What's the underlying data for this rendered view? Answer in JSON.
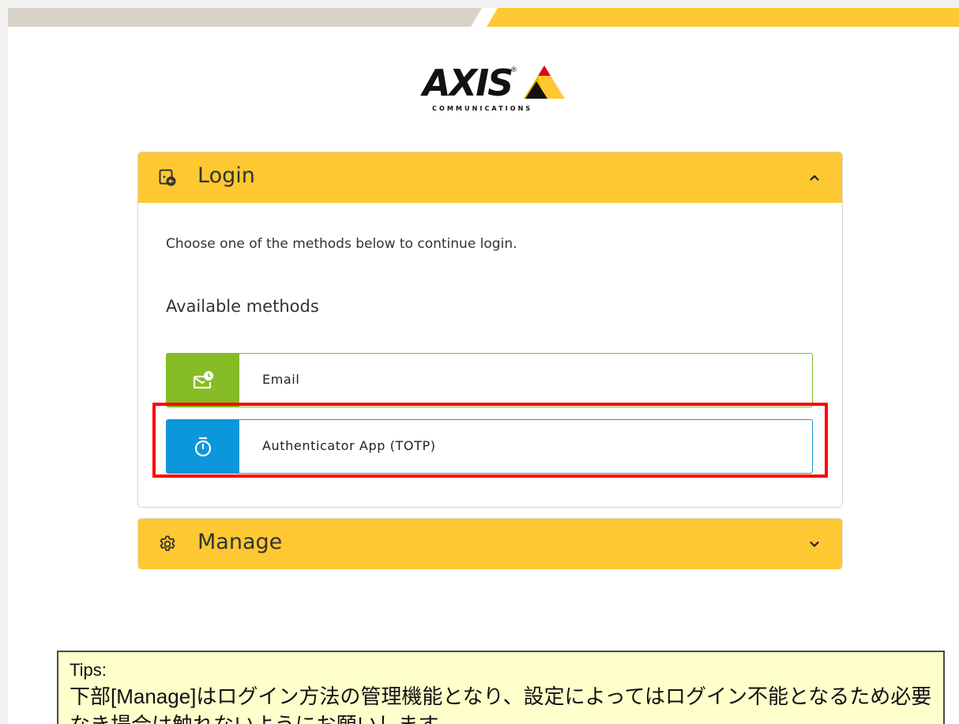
{
  "brand": {
    "logo_text": "AXIS",
    "logo_subtext": "COMMUNICATIONS",
    "colors": {
      "yellow": "#fdc832",
      "grey_stripe": "#d9d3c9",
      "email_green": "#86bc25",
      "totp_blue": "#0d97db",
      "highlight_red": "#ff0000"
    }
  },
  "login": {
    "title": "Login",
    "icon": "login-icon",
    "intro": "Choose one of the methods below to continue login.",
    "methods_title": "Available methods",
    "methods": [
      {
        "label": "Email",
        "icon": "email-icon"
      },
      {
        "label": "Authenticator App (TOTP)",
        "icon": "stopwatch-icon"
      }
    ]
  },
  "manage": {
    "title": "Manage",
    "icon": "gear-icon"
  },
  "tips": {
    "title": "Tips:",
    "body": "下部[Manage]はログイン方法の管理機能となり、設定によってはログイン不能となるため必要なき場合は触れないようにお願いします。"
  }
}
